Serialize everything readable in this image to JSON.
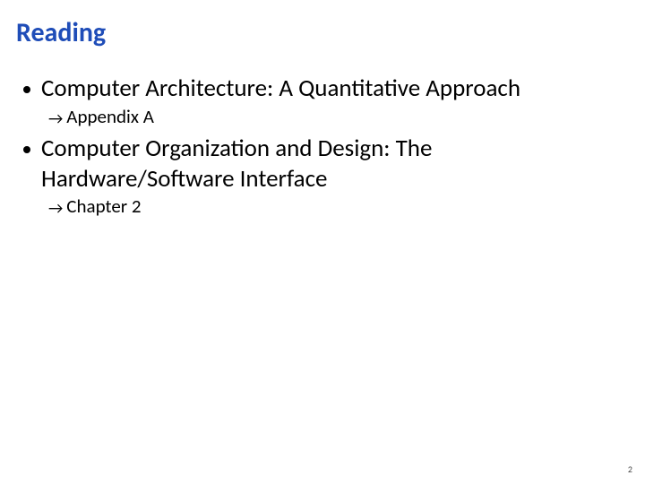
{
  "title": "Reading",
  "items": [
    {
      "text": "Computer Architecture: A Quantitative Approach",
      "sub": [
        {
          "text": "Appendix A"
        }
      ]
    },
    {
      "text": "Computer Organization and Design: The Hardware/Software Interface",
      "sub": [
        {
          "text": "Chapter 2"
        }
      ]
    }
  ],
  "page_number": "2"
}
